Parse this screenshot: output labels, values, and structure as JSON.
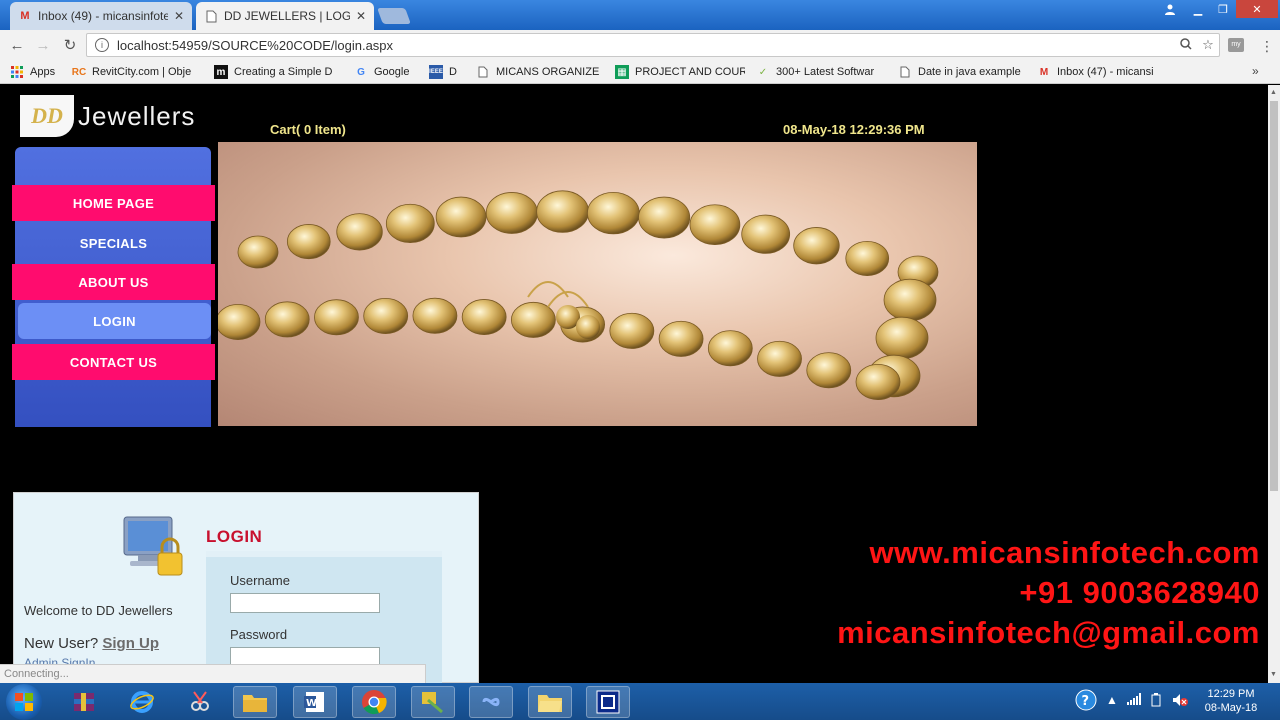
{
  "browser": {
    "tabs": [
      {
        "title": "Inbox (49) - micansinfote",
        "favicon": "gmail-icon",
        "active": false
      },
      {
        "title": "DD JEWELLERS | LOGIN",
        "favicon": "page-icon",
        "active": true
      }
    ],
    "url": "localhost:54959/SOURCE%20CODE/login.aspx",
    "bookmarks": [
      {
        "label": "Apps",
        "icon": "apps-grid-icon"
      },
      {
        "label": "RevitCity.com | Obje",
        "icon": "revitcity-icon"
      },
      {
        "label": "Creating a Simple D",
        "icon": "m-logo-icon"
      },
      {
        "label": "Google",
        "icon": "google-icon"
      },
      {
        "label": "D",
        "icon": "ieee-icon"
      },
      {
        "label": "MICANS ORGANIZE",
        "icon": "page-icon"
      },
      {
        "label": "PROJECT AND COUR",
        "icon": "sheets-icon"
      },
      {
        "label": "300+ Latest Softwar",
        "icon": "leaf-icon"
      },
      {
        "label": "Date in java example",
        "icon": "page-icon"
      },
      {
        "label": "Inbox (47) - micansi",
        "icon": "gmail-icon"
      }
    ],
    "status": "Connecting..."
  },
  "site": {
    "logo_text": "Jewellers",
    "logo_mark": "DD",
    "cart": "Cart( 0 Item)",
    "datetime": "08-May-18 12:29:36 PM",
    "nav": [
      {
        "label": "HOME PAGE",
        "style": "pink"
      },
      {
        "label": "SPECIALS",
        "style": "blue"
      },
      {
        "label": "ABOUT US",
        "style": "pink"
      },
      {
        "label": "LOGIN",
        "style": "active"
      },
      {
        "label": "CONTACT US",
        "style": "pink"
      }
    ]
  },
  "login": {
    "title": "LOGIN",
    "username_label": "Username",
    "username_value": "",
    "password_label": "Password",
    "password_value": "",
    "welcome": "Welcome to DD Jewellers",
    "new_user_text": "New User?",
    "signup_link": "Sign Up",
    "admin_link": "Admin SignIn"
  },
  "watermark": {
    "website": "www.micansinfotech.com",
    "phone": "+91 9003628940",
    "email": "micansinfotech@gmail.com"
  },
  "taskbar": {
    "time": "12:29 PM",
    "date": "08-May-18"
  },
  "colors": {
    "nav_pink": "#ff0c6e",
    "nav_blue": "#3b57c8",
    "nav_active": "#6c8ff5",
    "header_text": "#f0e68c",
    "login_title": "#c8102e",
    "watermark": "#ff1515"
  }
}
